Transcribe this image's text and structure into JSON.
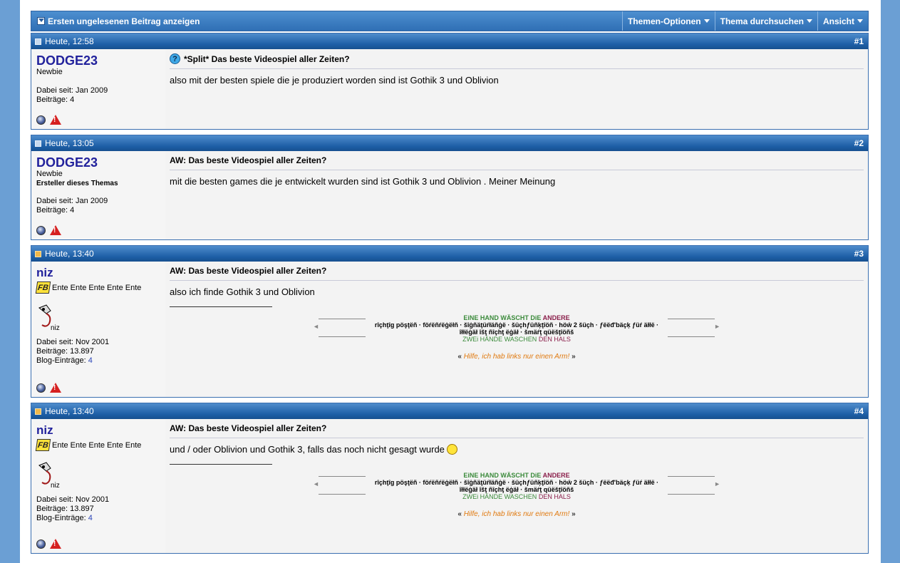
{
  "toolbar": {
    "first_unread": "Ersten ungelesenen Beitrag anzeigen",
    "thread_options": "Themen-Optionen",
    "search_thread": "Thema durchsuchen",
    "view": "Ansicht"
  },
  "posts": [
    {
      "date": "Heute, 12:58",
      "number": "#1",
      "username": "DODGE23",
      "usertitle": "Newbie",
      "starter": "",
      "joined": "Dabei seit: Jan 2009",
      "posts": "Beiträge: 4",
      "title": "*Split* Das beste Videospiel aller Zeiten?",
      "message": "also mit der besten spiele die je produziert worden sind ist Gothik 3 und Oblivion"
    },
    {
      "date": "Heute, 13:05",
      "number": "#2",
      "username": "DODGE23",
      "usertitle": "Newbie",
      "starter": "Ersteller dieses Themas",
      "joined": "Dabei seit: Jan 2009",
      "posts": "Beiträge: 4",
      "title": "AW: Das beste Videospiel aller Zeiten?",
      "message": "mit die besten games die je entwickelt wurden sind ist Gothik 3 und Oblivion . Meiner Meinung"
    },
    {
      "date": "Heute, 13:40",
      "number": "#3",
      "username": "niz",
      "ranks": "Ente Ente Ente Ente Ente",
      "fb_badge": "FB",
      "avatar_caption": "niz",
      "joined": "Dabei seit: Nov 2001",
      "posts": "Beiträge: 13.897",
      "blog_label": "Blog-Einträge:",
      "blog_count": "4",
      "title": "AW: Das beste Videospiel aller Zeiten?",
      "message": "also ich finde Gothik 3 und Oblivion"
    },
    {
      "date": "Heute, 13:40",
      "number": "#4",
      "username": "niz",
      "ranks": "Ente Ente Ente Ente Ente",
      "fb_badge": "FB",
      "avatar_caption": "niz",
      "joined": "Dabei seit: Nov 2001",
      "posts": "Beiträge: 13.897",
      "blog_label": "Blog-Einträge:",
      "blog_count": "4",
      "title": "AW: Das beste Videospiel aller Zeiten?",
      "message": "und / oder Oblivion und Gothik 3, falls das noch nicht gesagt wurde"
    }
  ],
  "signature": {
    "line1_a": "EiNE HAND WÄSCHT DiE",
    "line1_b": "ANDERE",
    "line2": "rîçhţîg pöşţëñ · föŕëñŕëġëłñ · šîġñäţüŕłäñġë · šüçhƒüñķţîöñ · höŵ 2 šüçh · ƒëëđ'bäçķ ƒüŕ äłłë · îłłëġäł îšţ ñîçhţ ëġäł · šmäŕţ qüëšţîöñš",
    "line3_a": "ZWEi HÄNDE WASCHEN",
    "line3_b": "DEN HALS",
    "hilfe": "Hilfe, ich hab links nur einen Arm!",
    "quote_open": "«",
    "quote_close": "»",
    "arrow_left": "◄",
    "arrow_right": "►"
  },
  "colors": {
    "header_blue": "#1d5ea6",
    "username_blue": "#22229c",
    "background": "#6b9fd4"
  }
}
